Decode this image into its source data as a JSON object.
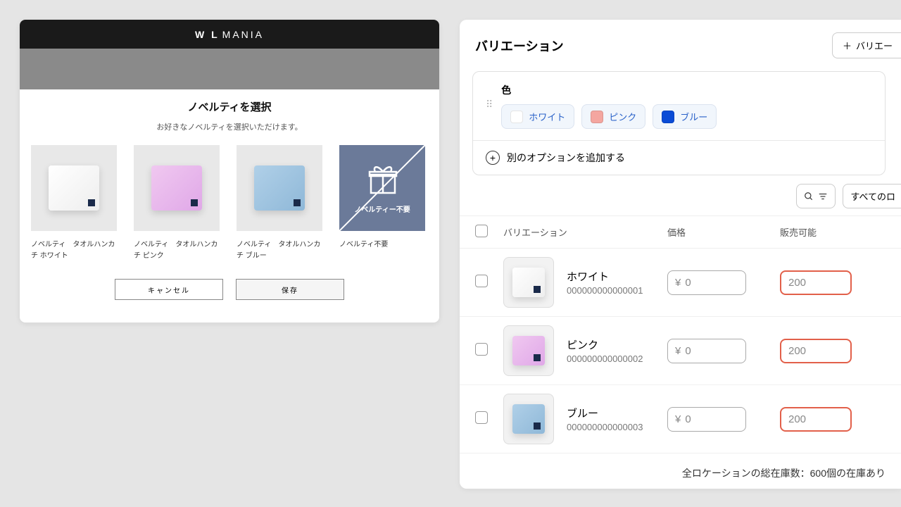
{
  "left": {
    "brand_bold": "W L",
    "brand_light": "MANIA",
    "title": "ノベルティを選択",
    "subtitle": "お好きなノベルティを選択いただけます。",
    "no_gift_label": "ノベルティー不要",
    "items": [
      {
        "name": "ノベルティ　タオルハンカチ ホワイト"
      },
      {
        "name": "ノベルティ　タオルハンカチ ピンク"
      },
      {
        "name": "ノベルティ　タオルハンカチ ブルー"
      },
      {
        "name": "ノベルティ不要"
      }
    ],
    "cancel": "キャンセル",
    "save": "保存"
  },
  "right": {
    "heading": "バリエーション",
    "add_button": "バリエー",
    "color_label": "色",
    "chips": [
      {
        "label": "ホワイト"
      },
      {
        "label": "ピンク"
      },
      {
        "label": "ブルー"
      }
    ],
    "add_option": "別のオプションを追加する",
    "all_locations": "すべてのロ",
    "columns": {
      "variation": "バリエーション",
      "price": "価格",
      "stock": "販売可能"
    },
    "currency": "¥",
    "rows": [
      {
        "name": "ホワイト",
        "sku": "000000000000001",
        "price": "0",
        "stock": "200"
      },
      {
        "name": "ピンク",
        "sku": "000000000000002",
        "price": "0",
        "stock": "200"
      },
      {
        "name": "ブルー",
        "sku": "000000000000003",
        "price": "0",
        "stock": "200"
      }
    ],
    "total": "全ロケーションの総在庫数：600個の在庫あり"
  }
}
